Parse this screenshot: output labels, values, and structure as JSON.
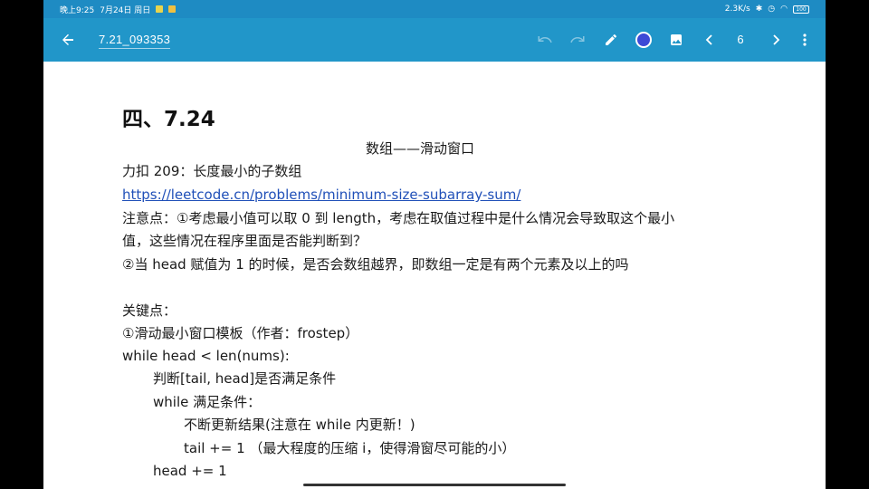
{
  "status_bar": {
    "time": "晚上9:25",
    "date": "7月24日 周日",
    "speed": "2.3K/s",
    "battery": "100"
  },
  "toolbar": {
    "title": "7.21_093353",
    "page_number": "6",
    "accent_color": "#2196c9",
    "pen_color": "#3d49d6",
    "icons": [
      "back-arrow-icon",
      "undo-icon",
      "redo-icon",
      "pen-icon",
      "color-picker-icon",
      "image-icon",
      "chevron-left-icon",
      "chevron-right-icon",
      "more-vert-icon"
    ]
  },
  "document": {
    "heading": "四、7.24",
    "lines": [
      "数组——滑动窗口",
      "力扣 209：长度最小的子数组",
      "https://leetcode.cn/problems/minimum-size-subarray-sum/",
      "注意点：①考虑最小值可以取 0 到 length，考虑在取值过程中是什么情况会导致取这个最小",
      "值，这些情况在程序里面是否能判断到？",
      "②当 head 赋值为 1 的时候，是否会数组越界，即数组一定是有两个元素及以上的吗",
      "关键点：",
      "①滑动最小窗口模板（作者：frostep）",
      "while head < len(nums):",
      "判断[tail, head]是否满足条件",
      "while  满足条件：",
      "不断更新结果(注意在 while 内更新！)",
      "tail += 1   （最大程度的压缩 i，使得滑窗尽可能的小）",
      "head += 1"
    ]
  }
}
